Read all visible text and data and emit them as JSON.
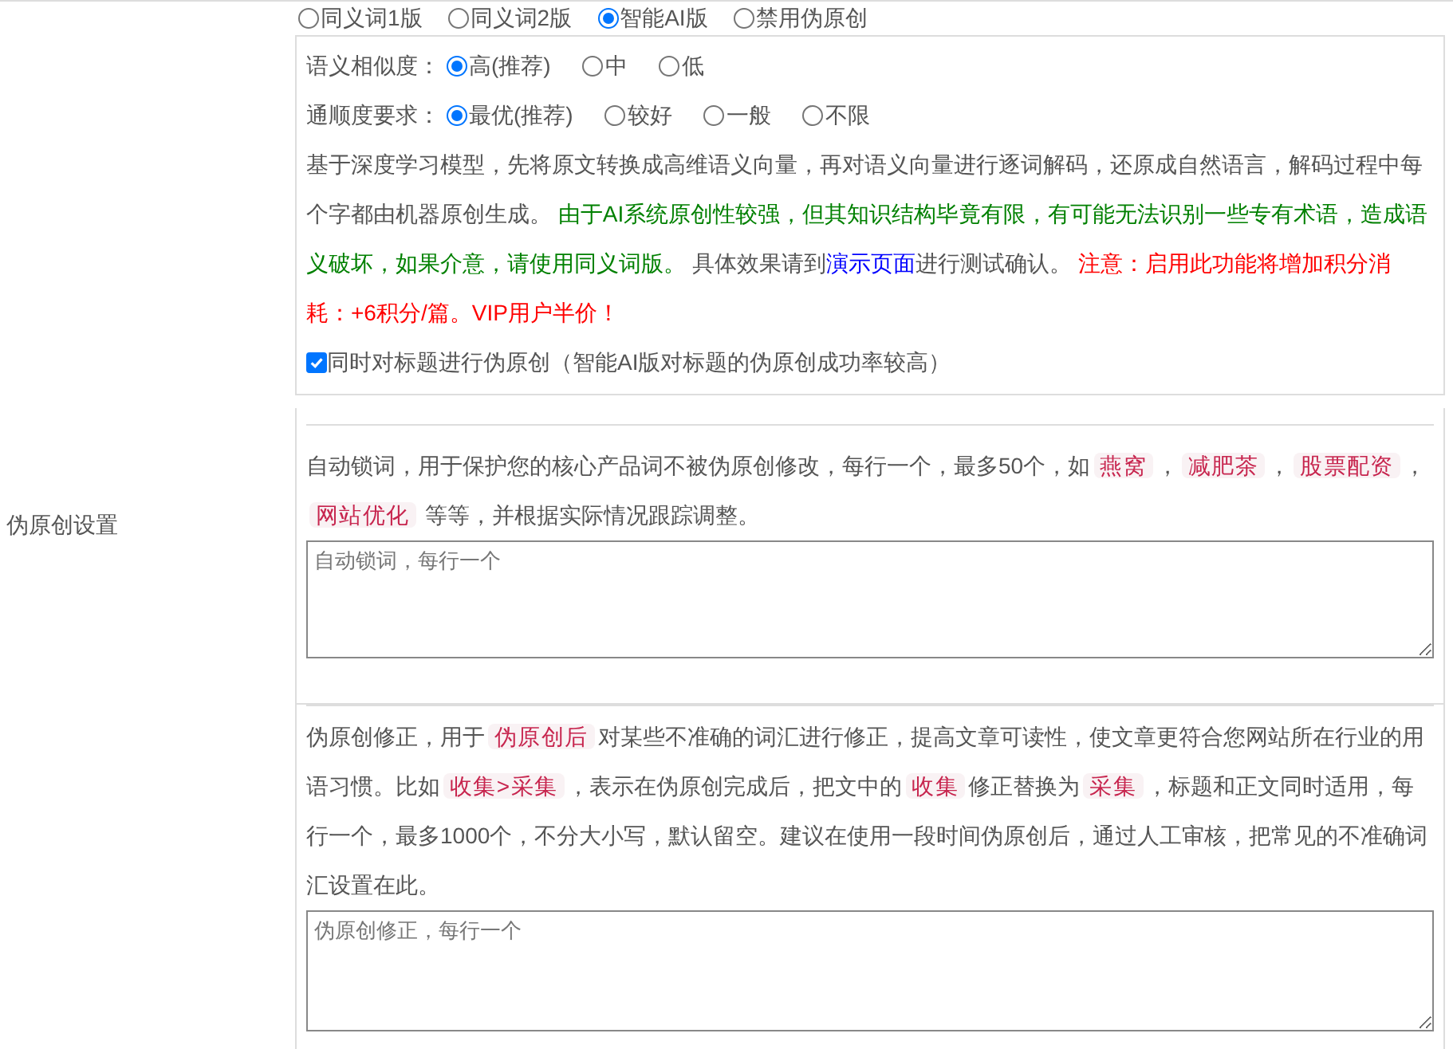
{
  "settings_label": "伪原创设置",
  "mode_options": [
    {
      "label": "同义词1版",
      "selected": false
    },
    {
      "label": "同义词2版",
      "selected": false
    },
    {
      "label": "智能AI版",
      "selected": true
    },
    {
      "label": "禁用伪原创",
      "selected": false
    }
  ],
  "similarity": {
    "label": "语义相似度：",
    "options": [
      {
        "label": "高(推荐)",
        "selected": true
      },
      {
        "label": "中",
        "selected": false
      },
      {
        "label": "低",
        "selected": false
      }
    ]
  },
  "fluency": {
    "label": "通顺度要求：",
    "options": [
      {
        "label": "最优(推荐)",
        "selected": true
      },
      {
        "label": "较好",
        "selected": false
      },
      {
        "label": "一般",
        "selected": false
      },
      {
        "label": "不限",
        "selected": false
      }
    ]
  },
  "ai_description": [
    {
      "kind": "plain",
      "text": "基于深度学习模型，先将原文转换成高维语义向量，再对语义向量进行逐词解码，还原成自然语言，解码过程中每个字都由机器原创生成。 "
    },
    {
      "kind": "green",
      "text": "由于AI系统原创性较强，但其知识结构毕竟有限，有可能无法识别一些专有术语，造成语义破坏，如果介意，请使用同义词版。"
    },
    {
      "kind": "plain",
      "text": " 具体效果请到"
    },
    {
      "kind": "link",
      "text": "演示页面"
    },
    {
      "kind": "plain",
      "text": "进行测试确认。 "
    },
    {
      "kind": "red",
      "text": "注意：启用此功能将增加积分消耗：+6积分/篇。VIP用户半价！"
    }
  ],
  "title_checkbox": {
    "label": "同时对标题进行伪原创（智能AI版对标题的伪原创成功率较高）",
    "checked": true
  },
  "lock_words": {
    "description": [
      {
        "kind": "plain",
        "text": "自动锁词，用于保护您的核心产品词不被伪原创修改，每行一个，最多50个，如"
      },
      {
        "kind": "code",
        "text": "燕窝"
      },
      {
        "kind": "plain",
        "text": "，"
      },
      {
        "kind": "code",
        "text": "减肥茶"
      },
      {
        "kind": "plain",
        "text": "，"
      },
      {
        "kind": "code",
        "text": "股票配资"
      },
      {
        "kind": "plain",
        "text": "，"
      },
      {
        "kind": "code",
        "text": "网站优化"
      },
      {
        "kind": "plain",
        "text": " 等等，并根据实际情况跟踪调整。"
      }
    ],
    "placeholder": "自动锁词，每行一个"
  },
  "corrections": {
    "description": [
      {
        "kind": "plain",
        "text": "伪原创修正，用于"
      },
      {
        "kind": "code",
        "text": "伪原创后"
      },
      {
        "kind": "plain",
        "text": "对某些不准确的词汇进行修正，提高文章可读性，使文章更符合您网站所在行业的用语习惯。比如"
      },
      {
        "kind": "code",
        "text": "收集>采集"
      },
      {
        "kind": "plain",
        "text": "，表示在伪原创完成后，把文中的"
      },
      {
        "kind": "code",
        "text": "收集"
      },
      {
        "kind": "plain",
        "text": "修正替换为"
      },
      {
        "kind": "code",
        "text": "采集"
      },
      {
        "kind": "plain",
        "text": "，标题和正文同时适用，每行一个，最多1000个，不分大小写，默认留空。建议在使用一段时间伪原创后，通过人工审核，把常见的不准确词汇设置在此。"
      }
    ],
    "placeholder": "伪原创修正，每行一个"
  }
}
